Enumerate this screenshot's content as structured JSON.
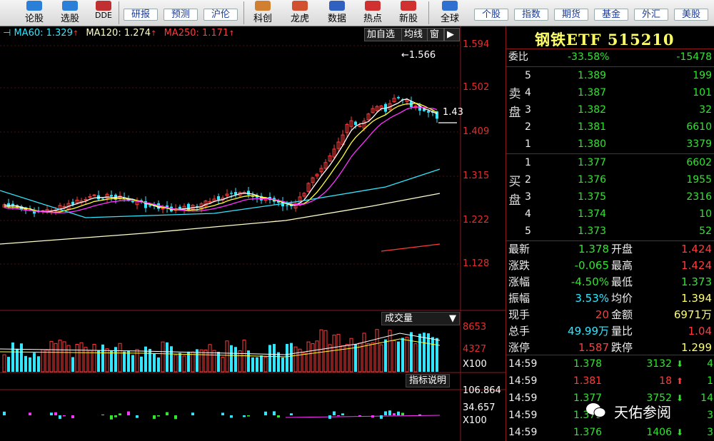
{
  "toolbar": {
    "icons": [
      {
        "label": "论股",
        "name": "lungu-icon",
        "color": "#2a7fd8"
      },
      {
        "label": "选股",
        "name": "xuangu-icon",
        "color": "#2a7fd8"
      },
      {
        "label": "DDE",
        "name": "dde-icon",
        "color": "#c03030"
      },
      {
        "label": "科创",
        "name": "kechuang-icon",
        "color": "#d08030"
      },
      {
        "label": "龙虎",
        "name": "longhu-icon",
        "color": "#d05030"
      },
      {
        "label": "数据",
        "name": "shuju-icon",
        "color": "#3060c0"
      },
      {
        "label": "热点",
        "name": "redian-icon",
        "color": "#d03030"
      },
      {
        "label": "新股",
        "name": "xingu-icon",
        "color": "#d03030"
      },
      {
        "label": "全球",
        "name": "quanqiu-icon",
        "color": "#3070d0"
      }
    ],
    "buttons": [
      "研报",
      "预测",
      "沪伦",
      "个股",
      "指数",
      "期货",
      "基金",
      "外汇",
      "美股"
    ]
  },
  "ma_legend": {
    "ma60": "MA60: 1.329",
    "ma120": "MA120: 1.274",
    "ma250": "MA250: 1.171",
    "ma60_color": "#33e6ff",
    "ma120_color": "#ffffcc",
    "ma250_color": "#ff3b3b"
  },
  "chart_tabs": [
    "加自选",
    "均线",
    "窗"
  ],
  "price_axis": [
    "1.594",
    "1.502",
    "1.409",
    "1.315",
    "1.222",
    "1.128"
  ],
  "annotations": {
    "high_marker": "1.566",
    "last_marker": "1.43"
  },
  "volume": {
    "label": "成交量",
    "ticks": [
      "8653",
      "4327"
    ],
    "unit": "X100"
  },
  "indicator": {
    "label": "指标说明",
    "ticks": [
      "106.864",
      "34.657"
    ],
    "unit": "X100"
  },
  "panel": {
    "title": "钢铁ETF 515210",
    "weibi": {
      "label": "委比",
      "pct": "-33.58%",
      "diff": "-15478"
    },
    "sell_label": "卖盘",
    "buy_label": "买盘",
    "asks": [
      {
        "lvl": "5",
        "price": "1.389",
        "vol": "199"
      },
      {
        "lvl": "4",
        "price": "1.387",
        "vol": "101"
      },
      {
        "lvl": "3",
        "price": "1.382",
        "vol": "32"
      },
      {
        "lvl": "2",
        "price": "1.381",
        "vol": "6610"
      },
      {
        "lvl": "1",
        "price": "1.380",
        "vol": "3379"
      }
    ],
    "bids": [
      {
        "lvl": "1",
        "price": "1.377",
        "vol": "6602"
      },
      {
        "lvl": "2",
        "price": "1.376",
        "vol": "1955"
      },
      {
        "lvl": "3",
        "price": "1.375",
        "vol": "2316"
      },
      {
        "lvl": "4",
        "price": "1.374",
        "vol": "10"
      },
      {
        "lvl": "5",
        "price": "1.373",
        "vol": "52"
      }
    ],
    "stats": [
      {
        "k1": "最新",
        "v1": "1.378",
        "k2": "开盘",
        "v2": "1.424"
      },
      {
        "k1": "涨跌",
        "v1": "-0.065",
        "k2": "最高",
        "v2": "1.424"
      },
      {
        "k1": "涨幅",
        "v1": "-4.50%",
        "k2": "最低",
        "v2": "1.373"
      },
      {
        "k1": "振幅",
        "v1": "3.53%",
        "k2": "均价",
        "v2": "1.394"
      },
      {
        "k1": "现手",
        "v1": "20",
        "k2": "金额",
        "v2": "6971万"
      },
      {
        "k1": "总手",
        "v1": "49.99万",
        "k2": "量比",
        "v2": "1.04"
      },
      {
        "k1": "涨停",
        "v1": "1.587",
        "k2": "跌停",
        "v2": "1.299"
      }
    ],
    "ticks": [
      {
        "time": "14:59",
        "price": "1.378",
        "vol": "3132",
        "dir": "down",
        "cnt": "4"
      },
      {
        "time": "14:59",
        "price": "1.381",
        "vol": "18",
        "dir": "up",
        "cnt": "1"
      },
      {
        "time": "14:59",
        "price": "1.377",
        "vol": "3752",
        "dir": "down",
        "cnt": "14"
      },
      {
        "time": "14:59",
        "price": "1.379",
        "vol": "",
        "dir": "",
        "cnt": "3"
      },
      {
        "time": "14:59",
        "price": "1.376",
        "vol": "1406",
        "dir": "down",
        "cnt": "3"
      }
    ]
  },
  "watermark": "天佑参阅"
}
